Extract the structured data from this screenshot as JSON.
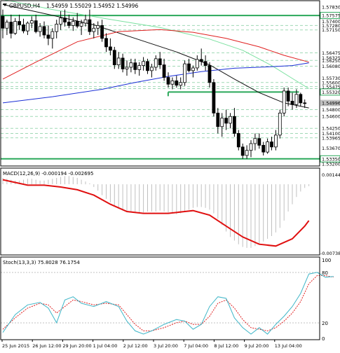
{
  "header": {
    "symbol": "GBPUSD,H4",
    "ohlc": "1.54959 1.55029 1.54952 1.54996"
  },
  "colors": {
    "background": "#ffffff",
    "frame": "#000000",
    "candle": "#000000",
    "grid": "#c8c8c8",
    "level_line": "#2aa85a",
    "ma_lime": "#7be1a0",
    "ma_black": "#111111",
    "ma_red": "#e02020",
    "ma_blue": "#1b2fd6",
    "macd_hist": "#c0c0c0",
    "macd_signal": "#e01010",
    "stoch_main": "#3fb6c8",
    "stoch_signal": "#e02020",
    "price_tag_bg": "#c0c0c0",
    "price_tag_level_bg": "#ffffff"
  },
  "chart_data": [
    {
      "id": "price",
      "type": "candlestick",
      "ylim": [
        1.5316,
        1.5799
      ],
      "price_labels": [
        "1.57830",
        "1.57575",
        "1.57400",
        "1.57280",
        "1.57150",
        "1.56475",
        "1.56325",
        "1.56250",
        "1.56080",
        "1.55730",
        "1.55600",
        "1.55475",
        "1.55320",
        "1.54996",
        "1.54800",
        "1.54600",
        "1.54250",
        "1.54100",
        "1.53965",
        "1.53670",
        "1.53350",
        "1.53200"
      ],
      "level_labels": [
        "1.57575",
        "1.55320",
        "1.53350"
      ],
      "current_price": "1.54996",
      "levels": [
        {
          "price": 1.57575,
          "from": 0,
          "to": 1
        },
        {
          "price": 1.5532,
          "from": 0.525,
          "to": 0.935
        },
        {
          "price": 1.5335,
          "from": 0,
          "to": 1
        }
      ],
      "dashed_levels": [
        1.5728,
        1.5715,
        1.56475,
        1.5625,
        1.5608,
        1.556,
        1.5548,
        1.5542,
        1.548,
        1.546,
        1.5425,
        1.541,
        1.5397
      ],
      "candles": [
        [
          1.5755,
          1.5775,
          1.569,
          1.572
        ],
        [
          1.572,
          1.5745,
          1.57,
          1.5738
        ],
        [
          1.5738,
          1.576,
          1.569,
          1.5705
        ],
        [
          1.5705,
          1.575,
          1.57,
          1.574
        ],
        [
          1.574,
          1.576,
          1.5715,
          1.573
        ],
        [
          1.573,
          1.5748,
          1.5705,
          1.5712
        ],
        [
          1.5712,
          1.574,
          1.57,
          1.5735
        ],
        [
          1.5735,
          1.5755,
          1.572,
          1.5742
        ],
        [
          1.5742,
          1.576,
          1.5705,
          1.571
        ],
        [
          1.571,
          1.5735,
          1.5695,
          1.5725
        ],
        [
          1.5725,
          1.574,
          1.569,
          1.57
        ],
        [
          1.57,
          1.5728,
          1.567,
          1.569
        ],
        [
          1.569,
          1.572,
          1.566,
          1.571
        ],
        [
          1.571,
          1.5745,
          1.569,
          1.5732
        ],
        [
          1.5732,
          1.577,
          1.5715,
          1.575
        ],
        [
          1.575,
          1.5775,
          1.5725,
          1.5738
        ],
        [
          1.5738,
          1.576,
          1.572,
          1.5728
        ],
        [
          1.5728,
          1.5752,
          1.5712,
          1.574
        ],
        [
          1.574,
          1.5765,
          1.572,
          1.5726
        ],
        [
          1.5726,
          1.5745,
          1.57,
          1.5735
        ],
        [
          1.5735,
          1.576,
          1.5725,
          1.5745
        ],
        [
          1.5745,
          1.5775,
          1.57,
          1.571
        ],
        [
          1.571,
          1.5735,
          1.569,
          1.572
        ],
        [
          1.572,
          1.574,
          1.57,
          1.5728
        ],
        [
          1.5728,
          1.5745,
          1.568,
          1.569
        ],
        [
          1.569,
          1.5705,
          1.565,
          1.5665
        ],
        [
          1.5665,
          1.569,
          1.564,
          1.5655
        ],
        [
          1.5655,
          1.5665,
          1.56,
          1.5612
        ],
        [
          1.5612,
          1.565,
          1.56,
          1.5632
        ],
        [
          1.5632,
          1.5645,
          1.559,
          1.56
        ],
        [
          1.56,
          1.5625,
          1.558,
          1.5605
        ],
        [
          1.5605,
          1.563,
          1.559,
          1.5618
        ],
        [
          1.5618,
          1.563,
          1.5585,
          1.5598
        ],
        [
          1.5598,
          1.562,
          1.558,
          1.561
        ],
        [
          1.561,
          1.5635,
          1.5595,
          1.5622
        ],
        [
          1.5622,
          1.563,
          1.5585,
          1.5595
        ],
        [
          1.5595,
          1.5615,
          1.5575,
          1.5605
        ],
        [
          1.5605,
          1.564,
          1.5595,
          1.563
        ],
        [
          1.563,
          1.565,
          1.56,
          1.5612
        ],
        [
          1.5612,
          1.563,
          1.5565,
          1.5575
        ],
        [
          1.5575,
          1.559,
          1.5545,
          1.5555
        ],
        [
          1.5555,
          1.5575,
          1.554,
          1.5565
        ],
        [
          1.5565,
          1.558,
          1.5545,
          1.5552
        ],
        [
          1.5552,
          1.5575,
          1.554,
          1.556
        ],
        [
          1.556,
          1.5625,
          1.555,
          1.5615
        ],
        [
          1.5615,
          1.563,
          1.559,
          1.5595
        ],
        [
          1.5595,
          1.561,
          1.5575,
          1.5603
        ],
        [
          1.5603,
          1.564,
          1.5595,
          1.5628
        ],
        [
          1.5628,
          1.566,
          1.561,
          1.5622
        ],
        [
          1.5622,
          1.564,
          1.5595,
          1.561
        ],
        [
          1.561,
          1.562,
          1.5545,
          1.556
        ],
        [
          1.556,
          1.557,
          1.546,
          1.547
        ],
        [
          1.547,
          1.5485,
          1.541,
          1.543
        ],
        [
          1.543,
          1.547,
          1.54,
          1.5455
        ],
        [
          1.5455,
          1.548,
          1.542,
          1.544
        ],
        [
          1.544,
          1.547,
          1.5425,
          1.546
        ],
        [
          1.546,
          1.5485,
          1.54,
          1.541
        ],
        [
          1.541,
          1.542,
          1.536,
          1.537
        ],
        [
          1.537,
          1.538,
          1.5335,
          1.5345
        ],
        [
          1.5345,
          1.5375,
          1.5335,
          1.536
        ],
        [
          1.536,
          1.539,
          1.534,
          1.538
        ],
        [
          1.538,
          1.541,
          1.536,
          1.5395
        ],
        [
          1.5395,
          1.541,
          1.5365,
          1.5375
        ],
        [
          1.5375,
          1.5385,
          1.5345,
          1.5355
        ],
        [
          1.5355,
          1.5395,
          1.535,
          1.5385
        ],
        [
          1.5385,
          1.54,
          1.536,
          1.537
        ],
        [
          1.537,
          1.542,
          1.536,
          1.5405
        ],
        [
          1.5405,
          1.548,
          1.5395,
          1.547
        ],
        [
          1.547,
          1.5545,
          1.546,
          1.5535
        ],
        [
          1.5535,
          1.5545,
          1.549,
          1.5505
        ],
        [
          1.5505,
          1.553,
          1.548,
          1.5495
        ],
        [
          1.5495,
          1.554,
          1.5485,
          1.5525
        ],
        [
          1.5525,
          1.553,
          1.549,
          1.55
        ],
        [
          1.55,
          1.551,
          1.5485,
          1.5499
        ]
      ],
      "moving_averages": [
        {
          "color_key": "ma_lime",
          "values": [
            [
              0,
              1.5805
            ],
            [
              12,
              1.5775
            ],
            [
              25,
              1.5748
            ],
            [
              38,
              1.5722
            ],
            [
              50,
              1.5688
            ],
            [
              58,
              1.5655
            ],
            [
              65,
              1.561
            ],
            [
              70,
              1.5572
            ],
            [
              74,
              1.5542
            ]
          ]
        },
        {
          "color_key": "ma_black",
          "values": [
            [
              0,
              1.579
            ],
            [
              12,
              1.5758
            ],
            [
              22,
              1.573
            ],
            [
              32,
              1.569
            ],
            [
              42,
              1.565
            ],
            [
              50,
              1.5612
            ],
            [
              56,
              1.557
            ],
            [
              62,
              1.553
            ],
            [
              68,
              1.55
            ],
            [
              74,
              1.5485
            ]
          ]
        },
        {
          "color_key": "ma_red",
          "values": [
            [
              0,
              1.557
            ],
            [
              8,
              1.562
            ],
            [
              18,
              1.568
            ],
            [
              28,
              1.571
            ],
            [
              38,
              1.5716
            ],
            [
              46,
              1.5708
            ],
            [
              54,
              1.569
            ],
            [
              62,
              1.5665
            ],
            [
              68,
              1.564
            ],
            [
              74,
              1.562
            ]
          ]
        },
        {
          "color_key": "ma_blue",
          "values": [
            [
              0,
              1.55
            ],
            [
              12,
              1.5518
            ],
            [
              24,
              1.554
            ],
            [
              32,
              1.556
            ],
            [
              40,
              1.5578
            ],
            [
              48,
              1.5592
            ],
            [
              56,
              1.5602
            ],
            [
              64,
              1.5606
            ],
            [
              70,
              1.561
            ],
            [
              74,
              1.5618
            ]
          ]
        }
      ]
    },
    {
      "id": "macd",
      "type": "bar+line",
      "title": "MACD(12,26,9) -0.000194 -0.002695",
      "ylim": [
        -0.0077,
        0.0017
      ],
      "axis_labels": [
        "0.001448",
        "-0.007385"
      ],
      "histogram": [
        0.0007,
        0.0006,
        0.0005,
        0.0004,
        0.0004,
        0.0005,
        0.0006,
        0.0006,
        0.0005,
        0.0004,
        0.0004,
        0.0005,
        0.0006,
        0.0007,
        0.0008,
        0.0009,
        0.0009,
        0.0008,
        0.0007,
        0.0005,
        0.0003,
        0.0001,
        -0.0003,
        -0.0007,
        -0.0012,
        -0.0016,
        -0.002,
        -0.0024,
        -0.0027,
        -0.0029,
        -0.003,
        -0.0031,
        -0.0031,
        -0.0031,
        -0.0031,
        -0.003,
        -0.003,
        -0.003,
        -0.0029,
        -0.003,
        -0.0031,
        -0.0032,
        -0.0033,
        -0.0032,
        -0.003,
        -0.0028,
        -0.0026,
        -0.0025,
        -0.0025,
        -0.0026,
        -0.0028,
        -0.0032,
        -0.0038,
        -0.0045,
        -0.0052,
        -0.0058,
        -0.0062,
        -0.0066,
        -0.0069,
        -0.007,
        -0.007,
        -0.0068,
        -0.0066,
        -0.0063,
        -0.006,
        -0.0057,
        -0.0053,
        -0.0048,
        -0.004,
        -0.003,
        -0.0022,
        -0.0014,
        -0.0008,
        -0.0004,
        -0.0002
      ],
      "signal": [
        [
          0,
          0.0005
        ],
        [
          3,
          0.0002
        ],
        [
          6,
          -0.0001
        ],
        [
          10,
          -0.0001
        ],
        [
          14,
          -0.0003
        ],
        [
          18,
          -0.0006
        ],
        [
          22,
          -0.0012
        ],
        [
          26,
          -0.0022
        ],
        [
          30,
          -0.003
        ],
        [
          34,
          -0.0032
        ],
        [
          40,
          -0.0032
        ],
        [
          44,
          -0.003
        ],
        [
          46,
          -0.0029
        ],
        [
          50,
          -0.0034
        ],
        [
          54,
          -0.0046
        ],
        [
          58,
          -0.0058
        ],
        [
          62,
          -0.0066
        ],
        [
          66,
          -0.0068
        ],
        [
          70,
          -0.006
        ],
        [
          73,
          -0.0046
        ],
        [
          74,
          -0.004
        ]
      ]
    },
    {
      "id": "stoch",
      "type": "line",
      "title": "Stoch(13,3,3) 75.8028 76.1754",
      "ylim": [
        0,
        100
      ],
      "axis_labels": [
        "100",
        "80",
        "20",
        "0"
      ],
      "guide_levels": [
        80,
        20
      ],
      "main": [
        [
          0,
          8
        ],
        [
          3,
          30
        ],
        [
          6,
          42
        ],
        [
          9,
          45
        ],
        [
          11,
          38
        ],
        [
          13,
          20
        ],
        [
          15,
          48
        ],
        [
          17,
          52
        ],
        [
          19,
          44
        ],
        [
          22,
          40
        ],
        [
          25,
          46
        ],
        [
          28,
          40
        ],
        [
          30,
          22
        ],
        [
          32,
          10
        ],
        [
          34,
          6
        ],
        [
          36,
          10
        ],
        [
          39,
          18
        ],
        [
          42,
          24
        ],
        [
          44,
          22
        ],
        [
          46,
          12
        ],
        [
          48,
          18
        ],
        [
          50,
          40
        ],
        [
          52,
          52
        ],
        [
          54,
          50
        ],
        [
          56,
          26
        ],
        [
          58,
          14
        ],
        [
          60,
          6
        ],
        [
          62,
          14
        ],
        [
          64,
          6
        ],
        [
          66,
          18
        ],
        [
          68,
          28
        ],
        [
          70,
          40
        ],
        [
          72,
          56
        ],
        [
          74,
          80
        ],
        [
          76,
          82
        ],
        [
          78,
          76
        ],
        [
          80,
          77
        ]
      ],
      "signal": [
        [
          0,
          12
        ],
        [
          3,
          26
        ],
        [
          6,
          38
        ],
        [
          9,
          44
        ],
        [
          11,
          42
        ],
        [
          13,
          32
        ],
        [
          15,
          40
        ],
        [
          17,
          48
        ],
        [
          19,
          46
        ],
        [
          22,
          42
        ],
        [
          25,
          44
        ],
        [
          28,
          42
        ],
        [
          30,
          30
        ],
        [
          32,
          18
        ],
        [
          34,
          10
        ],
        [
          36,
          10
        ],
        [
          39,
          14
        ],
        [
          42,
          20
        ],
        [
          44,
          22
        ],
        [
          46,
          18
        ],
        [
          48,
          18
        ],
        [
          50,
          28
        ],
        [
          52,
          44
        ],
        [
          54,
          48
        ],
        [
          56,
          38
        ],
        [
          58,
          24
        ],
        [
          60,
          14
        ],
        [
          62,
          12
        ],
        [
          64,
          10
        ],
        [
          66,
          14
        ],
        [
          68,
          22
        ],
        [
          70,
          32
        ],
        [
          72,
          46
        ],
        [
          74,
          68
        ],
        [
          76,
          78
        ],
        [
          78,
          78
        ],
        [
          80,
          76
        ]
      ]
    }
  ],
  "time_axis": {
    "labels": [
      "25 Jun 2015",
      "26 Jun 12:00",
      "29 Jun 20:00",
      "1 Jul 04:00",
      "2 Jul 12:00",
      "3 Jul 20:00",
      "7 Jul 04:00",
      "8 Jul 12:00",
      "9 Jul 20:00",
      "13 Jul 04:00"
    ]
  }
}
